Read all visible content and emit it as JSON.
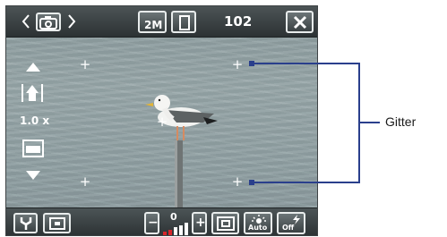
{
  "topbar": {
    "prev_icon": "chevron-left-icon",
    "mode_icon": "camera-icon",
    "next_icon": "chevron-right-icon",
    "resolution_label": "2M",
    "storage_icon": "memory-card-icon",
    "shots_remaining": "102",
    "close_icon": "close-icon"
  },
  "left_panel": {
    "zoom_in_icon": "triangle-up-icon",
    "zoom_level": "1.0 x",
    "zoom_out_icon": "triangle-down-icon"
  },
  "bottombar": {
    "settings_icon": "wrench-icon",
    "layout_icon": "grid-mode-icon",
    "brightness_minus": "−",
    "brightness_plus": "+",
    "brightness_value": "0",
    "white_balance_label": "Auto",
    "flash_label": "Off"
  },
  "callout": {
    "label": "Gitter"
  }
}
